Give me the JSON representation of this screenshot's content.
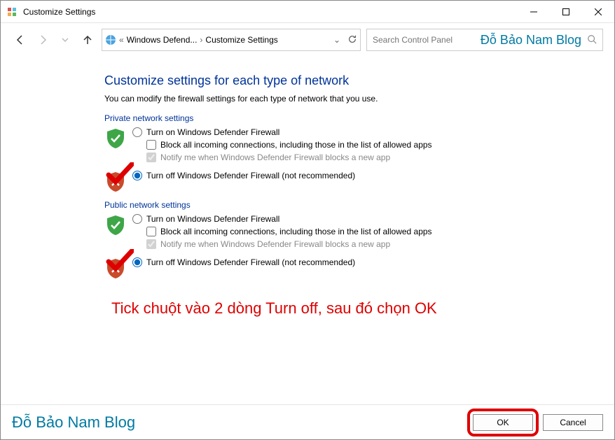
{
  "window": {
    "title": "Customize Settings"
  },
  "breadcrumb": {
    "levels": "«",
    "part1": "Windows Defend...",
    "part2": "Customize Settings"
  },
  "search": {
    "placeholder": "Search Control Panel"
  },
  "overlay_brand": "Đỗ Bảo Nam Blog",
  "page": {
    "title": "Customize settings for each type of network",
    "desc": "You can modify the firewall settings for each type of network that you use."
  },
  "private": {
    "label": "Private network settings",
    "on": "Turn on Windows Defender Firewall",
    "block": "Block all incoming connections, including those in the list of allowed apps",
    "notify": "Notify me when Windows Defender Firewall blocks a new app",
    "off": "Turn off Windows Defender Firewall (not recommended)"
  },
  "public": {
    "label": "Public network settings",
    "on": "Turn on Windows Defender Firewall",
    "block": "Block all incoming connections, including those in the list of allowed apps",
    "notify": "Notify me when Windows Defender Firewall blocks a new app",
    "off": "Turn off Windows Defender Firewall (not recommended)"
  },
  "annotation": "Tick chuột vào 2 dòng Turn off, sau đó chọn OK",
  "footer": {
    "brand": "Đỗ Bảo Nam Blog",
    "ok": "OK",
    "cancel": "Cancel"
  }
}
